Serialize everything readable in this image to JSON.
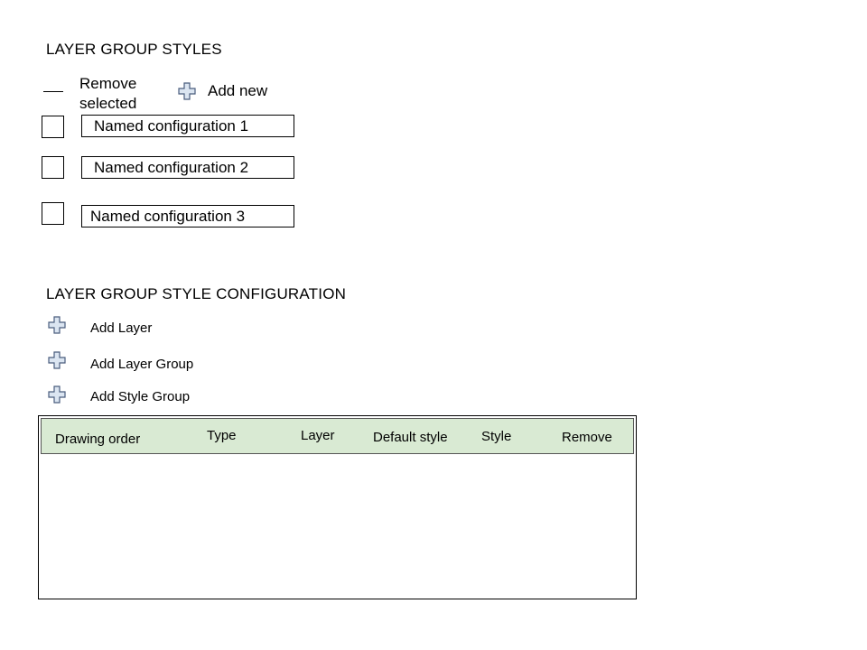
{
  "styles_section": {
    "title": "LAYER GROUP STYLES",
    "remove_selected_label_line1": "Remove",
    "remove_selected_label_line2": "selected",
    "add_new_label": "Add new",
    "configurations": [
      {
        "label": "Named configuration 1",
        "checked": false
      },
      {
        "label": "Named configuration 2",
        "checked": false
      },
      {
        "label": "Named configuration 3",
        "checked": false
      }
    ]
  },
  "config_section": {
    "title": "LAYER GROUP STYLE CONFIGURATION",
    "actions": [
      {
        "label": "Add Layer",
        "icon": "plus-icon"
      },
      {
        "label": "Add Layer Group",
        "icon": "plus-icon"
      },
      {
        "label": "Add Style Group",
        "icon": "plus-icon"
      }
    ],
    "table": {
      "columns": [
        "Drawing order",
        "Type",
        "Layer",
        "Default style",
        "Style",
        "Remove"
      ],
      "rows": [],
      "header_background": "#d9ead3"
    }
  },
  "colors": {
    "icon_fill": "#dbe5f1",
    "icon_stroke": "#4a5d7e"
  }
}
